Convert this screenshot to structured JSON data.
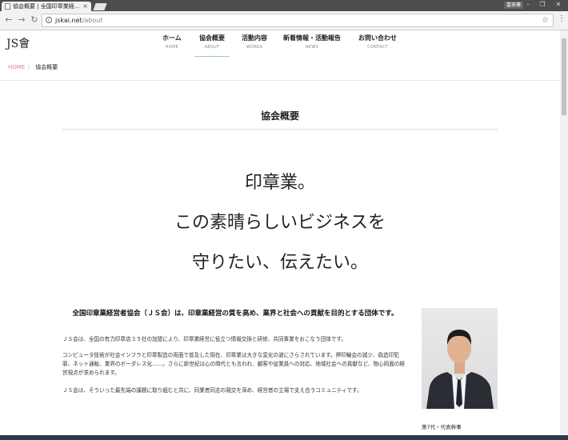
{
  "browser": {
    "tab_title": "協会概要 | 全国印章業経...",
    "tab_close": "×",
    "user_label": "富美樓",
    "url_host": "jskai.net",
    "url_path": "/about"
  },
  "site": {
    "logo": "JS會",
    "nav": [
      {
        "ja": "ホーム",
        "en": "HOME"
      },
      {
        "ja": "協会概要",
        "en": "ABOUT"
      },
      {
        "ja": "活動内容",
        "en": "WORKS"
      },
      {
        "ja": "新着情報・活動報告",
        "en": "NEWS"
      },
      {
        "ja": "お問い合わせ",
        "en": "CONTACT"
      }
    ],
    "active_nav": "ABOUT"
  },
  "breadcrumb": {
    "home": "HOME",
    "current": "協会概要"
  },
  "main": {
    "section_title": "協会概要",
    "hero_lines": [
      "印章業。",
      "この素晴らしいビジネスを",
      "守りたい、伝えたい。"
    ],
    "lead": "全国印章業経営者協会〔ＪＳ会〕は、印章業経営の質を高め、業界と社会への貢献を目的とする団体です。",
    "paragraphs": [
      "ＪＳ会は、全国の有力印章店３５社の加盟により、印章業経営に役立つ情報交換と研修、共同事業をおこなう団体です。",
      "コンピュータ技術が社会インフラと印章製造の両面で普及した現在、印章業は大きな変化の波にさらされています。押印輪会の減少、偽造印犯罪、ネット通販、業界のボーダレス化……。さらに新世紀は心の時代とも言われ、顧客や従業員への対応、地域社会への貢献など、物心両面の経営視点が求められます。",
      "ＪＳ会は、そういった最先端の課題に取り組むと共に、同業者同志の親交を深め、経営者の立場で支え合うコミュニティです。"
    ],
    "photo_caption": "第7代・代表幹事"
  }
}
